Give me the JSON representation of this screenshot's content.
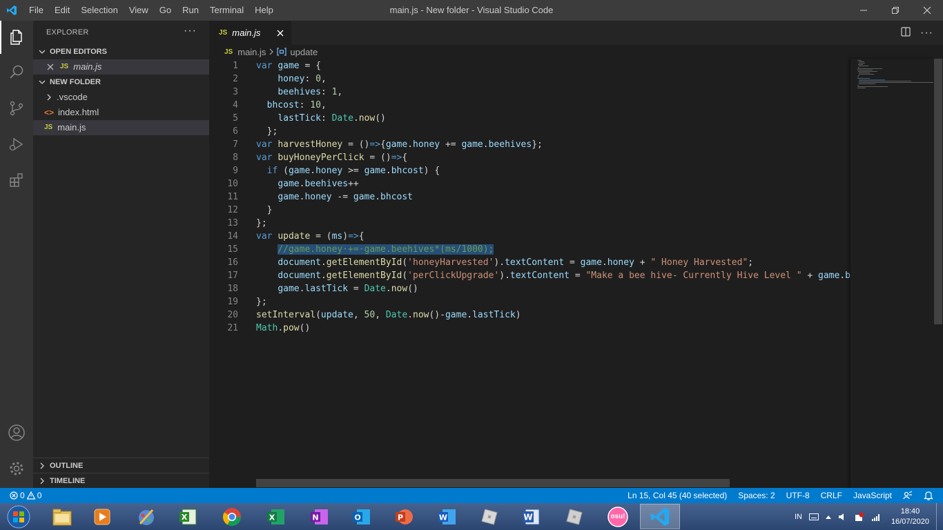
{
  "titlebar": {
    "menu": [
      "File",
      "Edit",
      "Selection",
      "View",
      "Go",
      "Run",
      "Terminal",
      "Help"
    ],
    "window_title": "main.js - New folder - Visual Studio Code"
  },
  "sidebar": {
    "header": "EXPLORER",
    "open_editors_title": "OPEN EDITORS",
    "open_editors": [
      {
        "badge": "JS",
        "name": "main.js"
      }
    ],
    "folder_title": "NEW FOLDER",
    "files": [
      {
        "name": ".vscode",
        "type": "folder"
      },
      {
        "name": "index.html",
        "type": "html"
      },
      {
        "name": "main.js",
        "type": "js",
        "badge": "JS"
      }
    ],
    "outline_title": "OUTLINE",
    "timeline_title": "TIMELINE"
  },
  "editor": {
    "tab": {
      "badge": "JS",
      "label": "main.js"
    },
    "breadcrumb": {
      "file_badge": "JS",
      "file": "main.js",
      "symbol": "update"
    },
    "line_numbers": [
      "1",
      "2",
      "3",
      "4",
      "5",
      "6",
      "7",
      "8",
      "9",
      "10",
      "11",
      "12",
      "13",
      "14",
      "15",
      "16",
      "17",
      "18",
      "19",
      "20",
      "21"
    ]
  },
  "statusbar": {
    "errors": "0",
    "warnings": "0",
    "position": "Ln 15, Col 45 (40 selected)",
    "spaces": "Spaces: 2",
    "encoding": "UTF-8",
    "eol": "CRLF",
    "language": "JavaScript"
  },
  "taskbar": {
    "apps": [
      "start-orb",
      "file-explorer",
      "media-player",
      "paint-tool",
      "excel-old",
      "chrome",
      "excel",
      "onenote",
      "outlook",
      "powerpoint",
      "word",
      "roblox",
      "word-old",
      "roblox-studio",
      "osu",
      "vscode"
    ],
    "osu_label": "osu!",
    "input_lang": "IN",
    "time": "18:40",
    "date": "16/07/2020"
  },
  "colors": {
    "accent": "#007acc",
    "titlebar": "#3c3c3c",
    "activitybar": "#333333",
    "sidebar": "#252526",
    "editor": "#1e1e1e"
  }
}
